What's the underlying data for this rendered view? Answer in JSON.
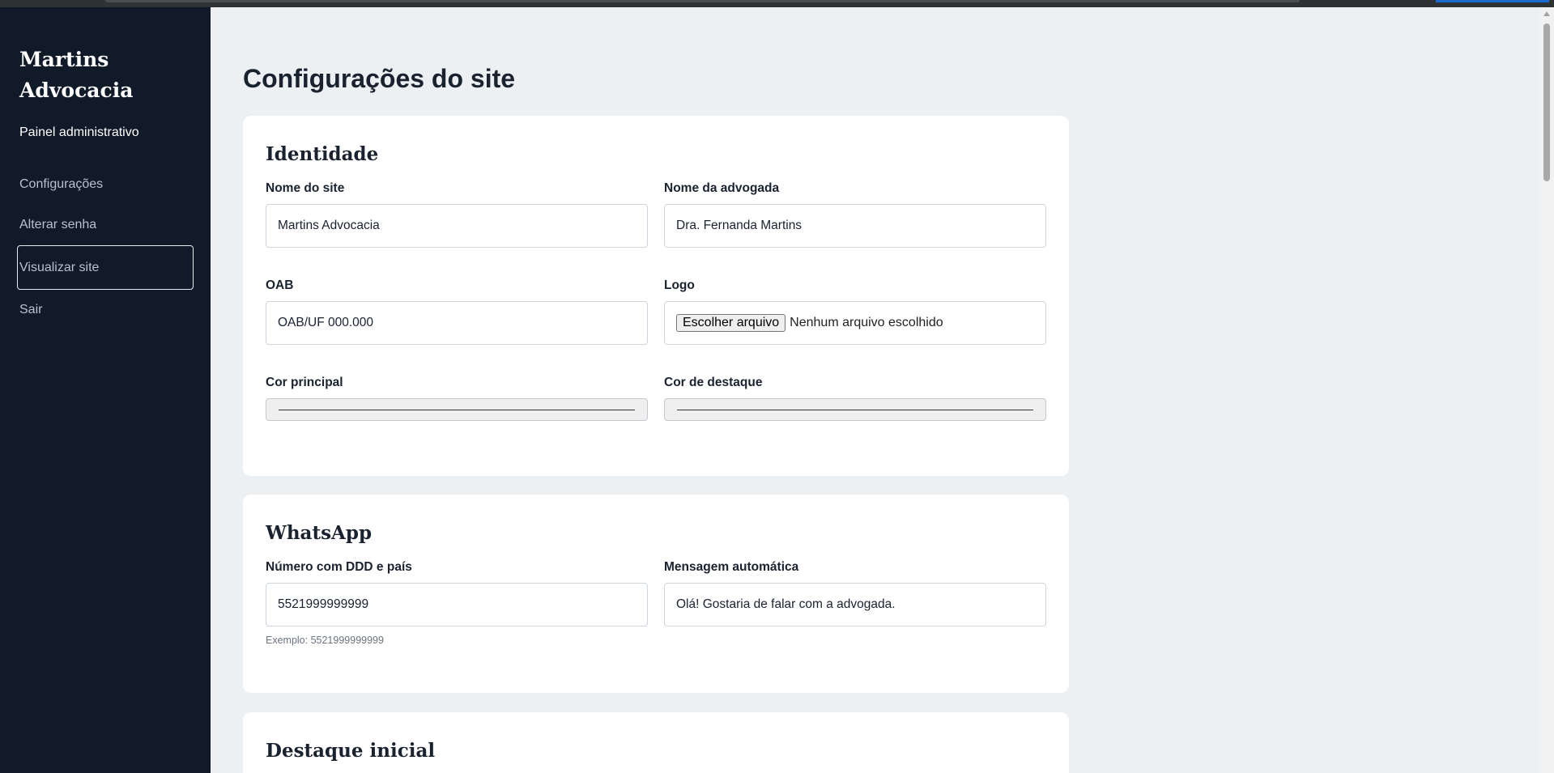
{
  "sidebar": {
    "brand": "Martins Advocacia",
    "panel_label": "Painel administrativo",
    "items": [
      {
        "label": "Configurações"
      },
      {
        "label": "Alterar senha"
      },
      {
        "label": "Visualizar site"
      },
      {
        "label": "Sair"
      }
    ]
  },
  "main": {
    "title": "Configurações do site",
    "identity": {
      "title": "Identidade",
      "site_name_label": "Nome do site",
      "site_name_value": "Martins Advocacia",
      "lawyer_name_label": "Nome da advogada",
      "lawyer_name_value": "Dra. Fernanda Martins",
      "oab_label": "OAB",
      "oab_value": "OAB/UF 000.000",
      "logo_label": "Logo",
      "logo_button": "Escolher arquivo",
      "logo_status": "Nenhum arquivo escolhido",
      "primary_color_label": "Cor principal",
      "primary_color_value": "#333333",
      "accent_color_label": "Cor de destaque",
      "accent_color_value": "#333333"
    },
    "whatsapp": {
      "title": "WhatsApp",
      "number_label": "Número com DDD e país",
      "number_value": "5521999999999",
      "number_hint": "Exemplo: 5521999999999",
      "message_label": "Mensagem automática",
      "message_value": "Olá! Gostaria de falar com a advogada."
    },
    "highlight": {
      "title": "Destaque inicial"
    }
  },
  "colors": {
    "sidebar_bg": "#111a28",
    "page_bg": "#edf0f3",
    "card_bg": "#ffffff",
    "text": "#1a2230"
  }
}
